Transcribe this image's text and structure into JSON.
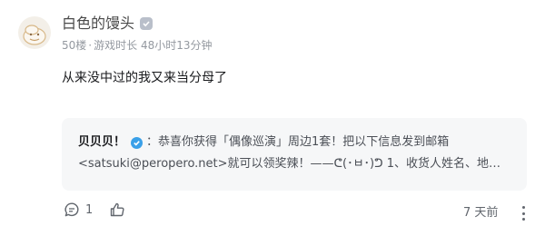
{
  "user": {
    "name": "白色的馒头",
    "floor": "50楼",
    "playtime_label": "游戏时长",
    "playtime": "48小时13分钟"
  },
  "post": {
    "text": "从来没中过的我又来当分母了"
  },
  "quote": {
    "author": "贝贝贝！",
    "line1": "：恭喜你获得「偶像巡演」周边1套！把以下信息发到邮箱",
    "line2": "<satsuki@peropero.net>就可以领奖辣！——ᕦ(･ㅂ･)ᕤ 1、收货人姓名、地…"
  },
  "actions": {
    "comment_count": "1",
    "time": "7 天前"
  },
  "icons": {
    "comment": "comment-icon",
    "like": "thumbs-up-icon",
    "more": "more-vertical-icon",
    "verified": "verified-check-icon"
  },
  "colors": {
    "verified": "#3aa0e8",
    "quote_bg": "#f6f7f8",
    "muted": "#9499a0"
  }
}
